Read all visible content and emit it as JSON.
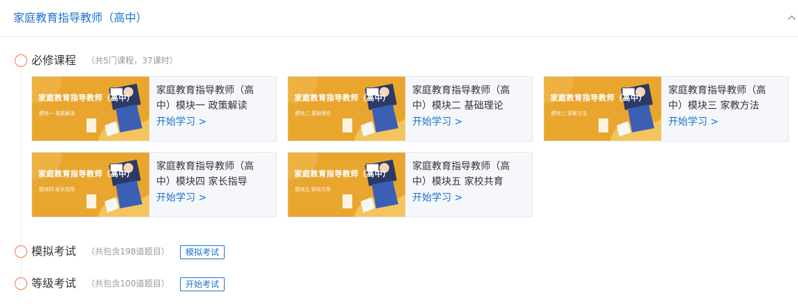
{
  "header": {
    "title": "家庭教育指导教师（高中）"
  },
  "required": {
    "title": "必修课程",
    "meta": "（共5门课程，37课时）",
    "courses": [
      {
        "thumb_title": "家庭教育指导教师（高中）",
        "thumb_sub": "模块一 政策解读",
        "name": "家庭教育指导教师（高中）模块一 政策解读",
        "link": "开始学习 >"
      },
      {
        "thumb_title": "家庭教育指导教师（高中）",
        "thumb_sub": "模块二 基础理论",
        "name": "家庭教育指导教师（高中）模块二 基础理论",
        "link": "开始学习 >"
      },
      {
        "thumb_title": "家庭教育指导教师（高中）",
        "thumb_sub": "模块三 家教方法",
        "name": "家庭教育指导教师（高中）模块三 家教方法",
        "link": "开始学习 >"
      },
      {
        "thumb_title": "家庭教育指导教师（高中）",
        "thumb_sub": "模块四 家长指导",
        "name": "家庭教育指导教师（高中）模块四 家长指导",
        "link": "开始学习 >"
      },
      {
        "thumb_title": "家庭教育指导教师（高中）",
        "thumb_sub": "模块五 家校共育",
        "name": "家庭教育指导教师（高中）模块五 家校共育",
        "link": "开始学习 >"
      }
    ]
  },
  "mock": {
    "title": "模拟考试",
    "meta": "（共包含198道题目）",
    "button": "模拟考试"
  },
  "grade": {
    "title": "等级考试",
    "meta": "（共包含100道题目）",
    "button": "开始考试"
  },
  "colors": {
    "accent": "#1a73c9",
    "circle": "#f07a3a",
    "thumb_bg": "#e9a62f"
  }
}
